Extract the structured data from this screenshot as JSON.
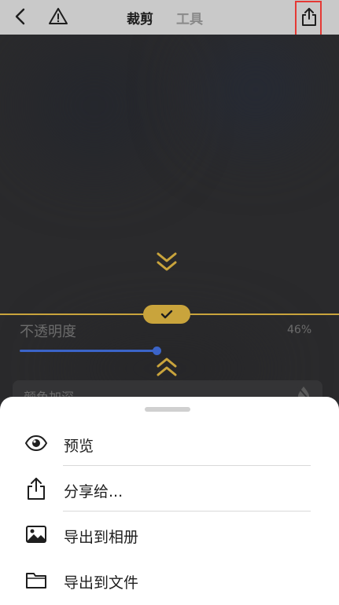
{
  "topbar": {
    "tab_crop": "裁剪",
    "tab_tools": "工具",
    "icons": [
      "chevron-left-icon",
      "warning-icon",
      "share-icon"
    ]
  },
  "editor": {
    "opacity_label": "不透明度",
    "opacity_value": "46%",
    "opacity_level": 0.46,
    "blend_mode": "颜色加深",
    "accent_color": "#c9a43c",
    "slider_color": "#3b64c8"
  },
  "sheet": {
    "items": [
      {
        "label": "预览",
        "icon": "eye-icon"
      },
      {
        "label": "分享给...",
        "icon": "share-icon"
      },
      {
        "label": "导出到相册",
        "icon": "photo-icon"
      },
      {
        "label": "导出到文件",
        "icon": "folder-icon"
      }
    ]
  }
}
